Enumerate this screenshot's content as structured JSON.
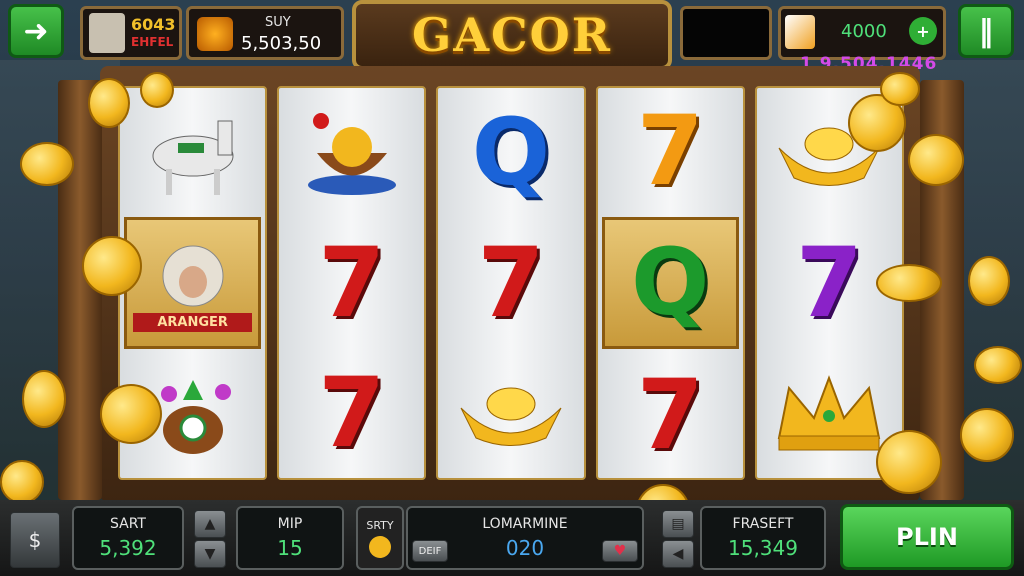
{
  "header": {
    "title": "GACOR",
    "player_badge_top": "6043",
    "player_badge_bottom": "EHFEL",
    "bet_label": "SUY",
    "bet_value": "5,503,50",
    "credit_value": "4000",
    "jackpot_value": "1 9,504,1446"
  },
  "reels": [
    [
      {
        "type": "image",
        "icon": "horse-icon"
      },
      {
        "type": "image",
        "icon": "monkey-character-icon",
        "highlight": true,
        "label": "ARANGER"
      },
      {
        "type": "image",
        "icon": "potted-plant-icon"
      }
    ],
    [
      {
        "type": "image",
        "icon": "fruit-bowl-icon"
      },
      {
        "type": "seven",
        "color": "red",
        "text": "7"
      },
      {
        "type": "seven",
        "color": "red",
        "text": "7"
      }
    ],
    [
      {
        "type": "letter",
        "color": "blue",
        "text": "Q"
      },
      {
        "type": "seven",
        "color": "red",
        "text": "7"
      },
      {
        "type": "image",
        "icon": "gold-ingot-icon"
      }
    ],
    [
      {
        "type": "seven",
        "color": "orange",
        "text": "7"
      },
      {
        "type": "letter",
        "color": "green",
        "text": "Q",
        "highlight": true
      },
      {
        "type": "seven",
        "color": "red",
        "text": "7"
      }
    ],
    [
      {
        "type": "image",
        "icon": "gold-ingot-icon"
      },
      {
        "type": "seven",
        "color": "purple",
        "text": "7"
      },
      {
        "type": "image",
        "icon": "crown-icon"
      }
    ]
  ],
  "footer": {
    "start_label": "SART",
    "start_value": "5,392",
    "mip_label": "MIP",
    "mip_value": "15",
    "auto_label": "SRTY",
    "middle_label": "LOMARMINE",
    "middle_value": "020",
    "middle_left_btn": "DEIF",
    "preset_label": "FRASEFT",
    "preset_value": "15,349",
    "spin_label": "PLIN"
  },
  "colors": {
    "accent": "#ffcf3a",
    "spin": "#2fae35",
    "value_green": "#4fe07a"
  }
}
